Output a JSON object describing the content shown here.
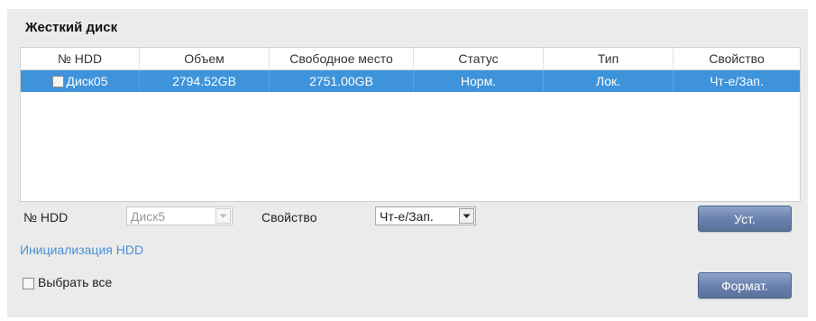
{
  "panel": {
    "title": "Жесткий диск"
  },
  "table": {
    "headers": [
      "№ HDD",
      "Объем",
      "Свободное место",
      "Статус",
      "Тип",
      "Свойство"
    ],
    "rows": [
      {
        "hdd": "Диск05",
        "capacity": "2794.52GB",
        "free": "2751.00GB",
        "status": "Норм.",
        "type": "Лок.",
        "property": "Чт-е/Зап.",
        "selected": true
      }
    ]
  },
  "form": {
    "hdd_label": "№ HDD",
    "hdd_value": "Диск5",
    "property_label": "Свойство",
    "property_value": "Чт-е/Зап.",
    "set_button": "Уст.",
    "init_link": "Инициализация HDD",
    "select_all_label": "Выбрать все",
    "format_button": "Формат."
  },
  "colors": {
    "selected_row": "#3e93db",
    "button": "#6a82ae",
    "link": "#4c8fd6"
  },
  "icons": {
    "dropdown": "chevron-down-icon",
    "row_checkbox": "checkbox-icon"
  }
}
